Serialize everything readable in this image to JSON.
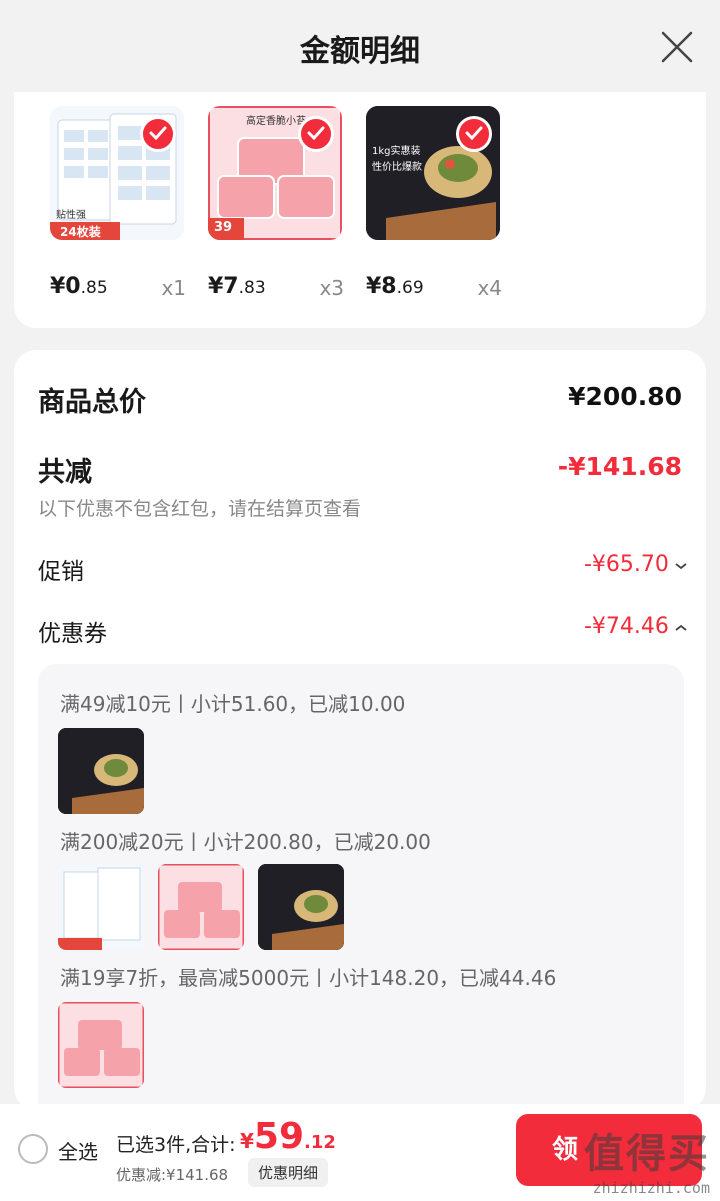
{
  "header": {
    "title": "金额明细",
    "close_icon": "close-icon"
  },
  "products": [
    {
      "name": "label-sticker",
      "badge": "24枚装",
      "price_main": "¥0",
      "price_frac": ".85",
      "qty": "x1",
      "checked": true
    },
    {
      "name": "seaweed-box",
      "badge": "39",
      "price_main": "¥7",
      "price_frac": ".83",
      "qty": "x3",
      "checked": true
    },
    {
      "name": "dumpling-pack",
      "badge": "1kg实惠装 性价比爆款",
      "price_main": "¥8",
      "price_frac": ".69",
      "qty": "x4",
      "checked": true
    }
  ],
  "product_thumb_text": {
    "p1_a": "贴性强",
    "p1_b": "24枚装",
    "p2_a": "高定香脆小苔",
    "p2_b": "39",
    "p3_a": "1kg实惠装",
    "p3_b": "性价比爆款"
  },
  "summary": {
    "total_label": "商品总价",
    "total_value": "¥200.80",
    "reduce_label": "共减",
    "reduce_value": "-¥141.68",
    "note": "以下优惠不包含红包，请在结算页查看",
    "promo_label": "促销",
    "promo_value": "-¥65.70",
    "coupon_label": "优惠券",
    "coupon_value": "-¥74.46"
  },
  "coupons": [
    {
      "text": "满49减10元丨小计51.60，已减10.00"
    },
    {
      "text": "满200减20元丨小计200.80，已减20.00"
    },
    {
      "text": "满19享7折，最高减5000元丨小计148.20，已减44.46"
    }
  ],
  "footer": {
    "select_all": "全选",
    "selected_summary": "已选3件,合计:",
    "currency": "¥",
    "total_int": "59",
    "total_frac": ".12",
    "discount_text": "优惠减:¥141.68",
    "detail_button": "优惠明细",
    "checkout_label": "领"
  },
  "watermark": {
    "big": "值得买",
    "small": "zhizhizhi.com"
  },
  "colors": {
    "accent": "#f22c3a",
    "background": "#f2f2f2"
  }
}
